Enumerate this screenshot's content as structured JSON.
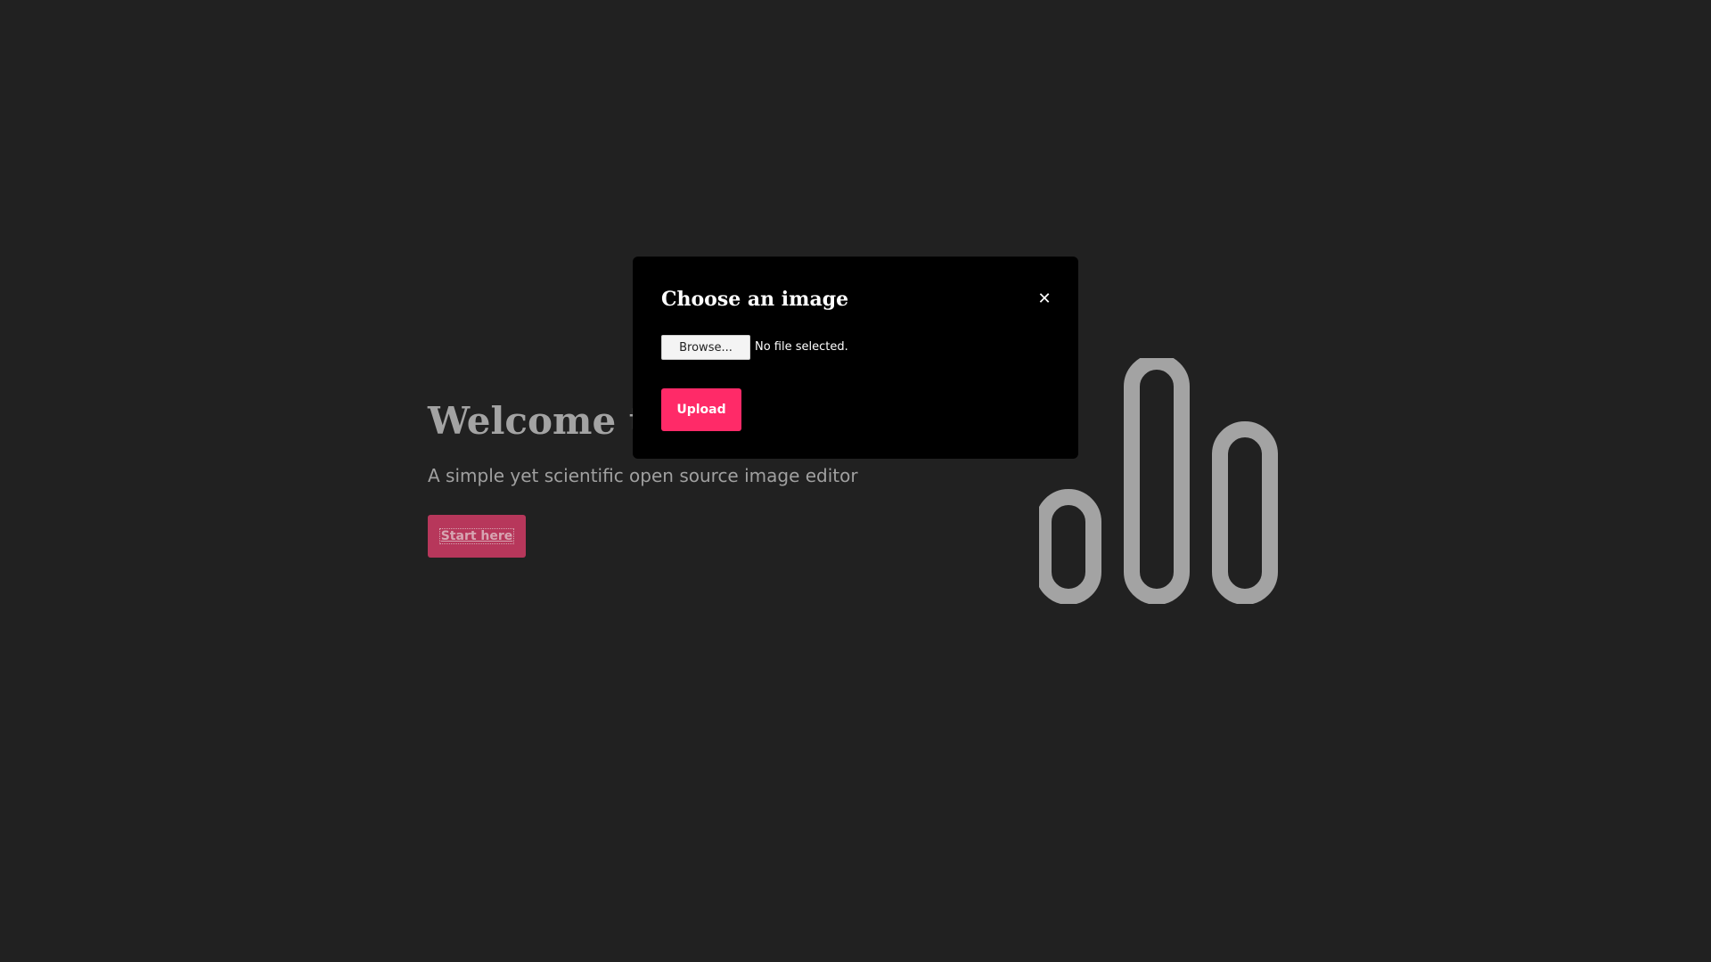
{
  "hero": {
    "title": "Welcome to ",
    "subtitle": "A simple yet scientific open source image editor",
    "start_label": "Start here"
  },
  "modal": {
    "title": "Choose an image",
    "close_icon": "close-icon",
    "close_glyph": "✕",
    "browse_label": "Browse...",
    "file_status": "No file selected.",
    "upload_label": "Upload"
  },
  "logo": {
    "icon": "app-logo-icon"
  },
  "colors": {
    "background": "#212121",
    "modal_background": "#000000",
    "accent": "#ff2a68",
    "dimmed_accent": "#b7375b",
    "logo_gray": "#a3a3a3"
  }
}
